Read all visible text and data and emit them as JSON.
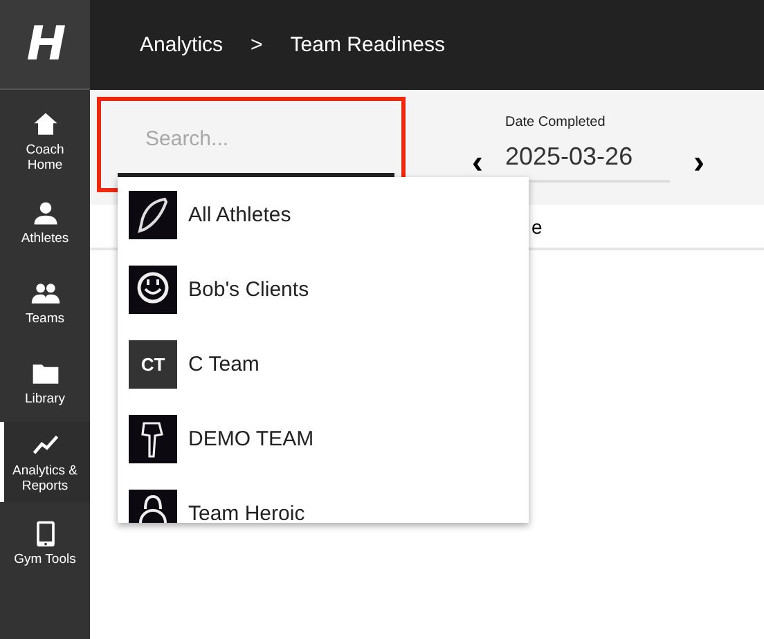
{
  "logo": {
    "text": "H"
  },
  "sidebar": {
    "items": [
      {
        "label": "Coach Home",
        "selected": false
      },
      {
        "label": "Athletes",
        "selected": false
      },
      {
        "label": "Teams",
        "selected": false
      },
      {
        "label": "Library",
        "selected": false
      },
      {
        "label": "Analytics & Reports",
        "selected": true
      },
      {
        "label": "Gym Tools",
        "selected": false
      }
    ]
  },
  "breadcrumb": [
    {
      "label": "Analytics"
    },
    {
      "label": "Team Readiness"
    }
  ],
  "breadcrumb_separator": ">",
  "search": {
    "placeholder": "Search..."
  },
  "date": {
    "label": "Date Completed",
    "value": "2025-03-26",
    "prev": "‹",
    "next": "›"
  },
  "table": {
    "columns": [
      "e"
    ]
  },
  "dropdown": {
    "items": [
      {
        "label": "All Athletes"
      },
      {
        "label": "Bob's Clients"
      },
      {
        "label": "C Team",
        "initials": "CT"
      },
      {
        "label": "DEMO TEAM"
      },
      {
        "label": "Team Heroic"
      }
    ]
  }
}
